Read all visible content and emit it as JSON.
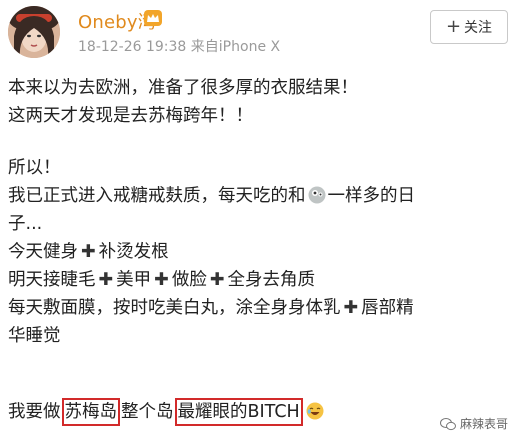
{
  "post": {
    "username": "Oneby湾",
    "username_badge": "crown-icon",
    "timestamp": "18-12-26 19:38",
    "source": "来自iPhone X",
    "follow_label": "关注",
    "follow_icon": "plus-icon"
  },
  "content": {
    "line1": "本来以为去欧洲，准备了很多厚的衣服结果！",
    "line2": "这两天才发现是去苏梅跨年！！",
    "line3": "所以！",
    "line4a": "我已正式进入戒糖戒麸质，每天吃的和",
    "line4b": "一样多的日",
    "line5": "子...",
    "line6a": "今天健身",
    "line6b": "补烫发根",
    "line7a": "明天接睫毛",
    "line7b": "美甲",
    "line7c": "做脸",
    "line7d": "全身去角质",
    "line8a": "每天敷面膜，按时吃美白丸，涂全身身体乳",
    "line8b": "唇部精",
    "line9": "华睡觉",
    "last_a": "我要做",
    "last_box1": "苏梅岛",
    "last_b": "整个岛",
    "last_box2": "最耀眼的BITCH"
  },
  "watermark": {
    "text": "麻辣表哥"
  },
  "colors": {
    "username": "#e08a1e",
    "highlight_box": "#d22a2a",
    "meta": "#9a9a9a"
  }
}
